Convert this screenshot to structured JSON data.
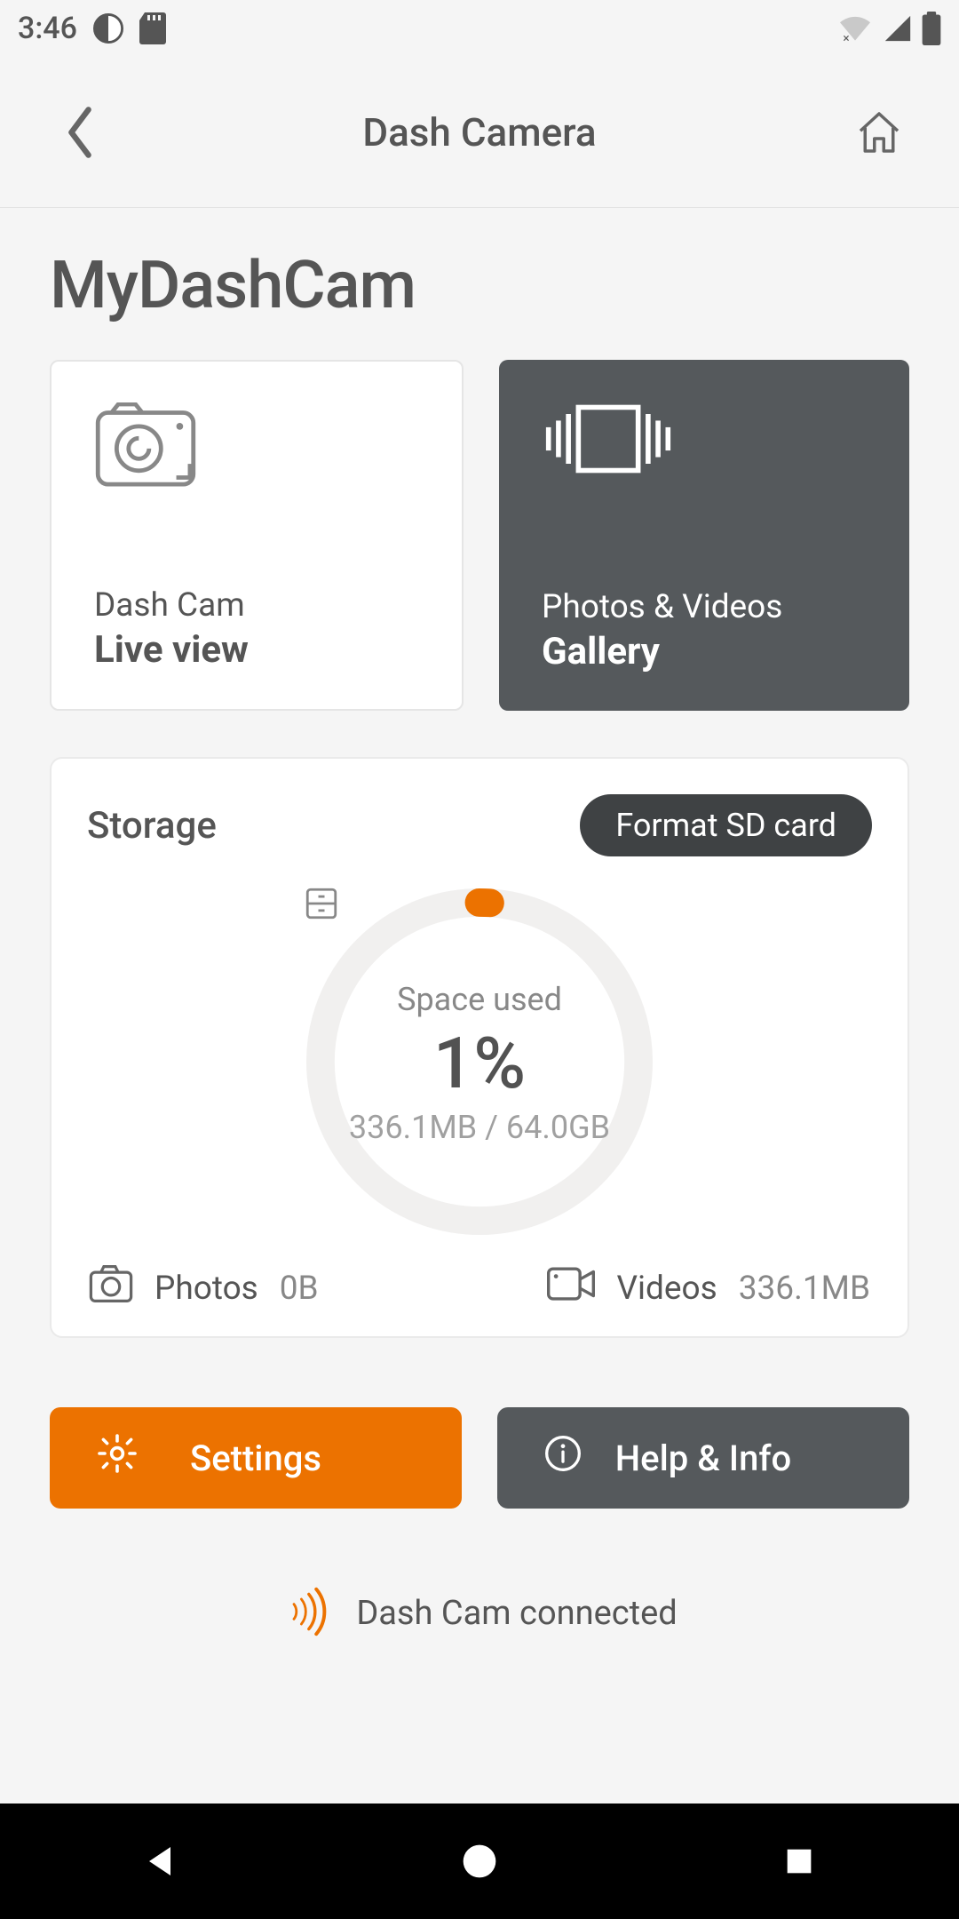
{
  "status": {
    "time": "3:46"
  },
  "header": {
    "title": "Dash Camera"
  },
  "device": {
    "name": "MyDashCam"
  },
  "cards": {
    "live": {
      "sub": "Dash Cam",
      "title": "Live view"
    },
    "gallery": {
      "sub": "Photos & Videos",
      "title": "Gallery"
    }
  },
  "storage": {
    "label": "Storage",
    "format_btn": "Format SD card",
    "space_used_label": "Space used",
    "percent": "1%",
    "detail": "336.1MB / 64.0GB",
    "photos_label": "Photos",
    "photos_value": "0B",
    "videos_label": "Videos",
    "videos_value": "336.1MB"
  },
  "actions": {
    "settings": "Settings",
    "help": "Help & Info"
  },
  "connection": {
    "text": "Dash Cam connected"
  },
  "colors": {
    "accent": "#ec7200",
    "dark": "#55595c"
  }
}
